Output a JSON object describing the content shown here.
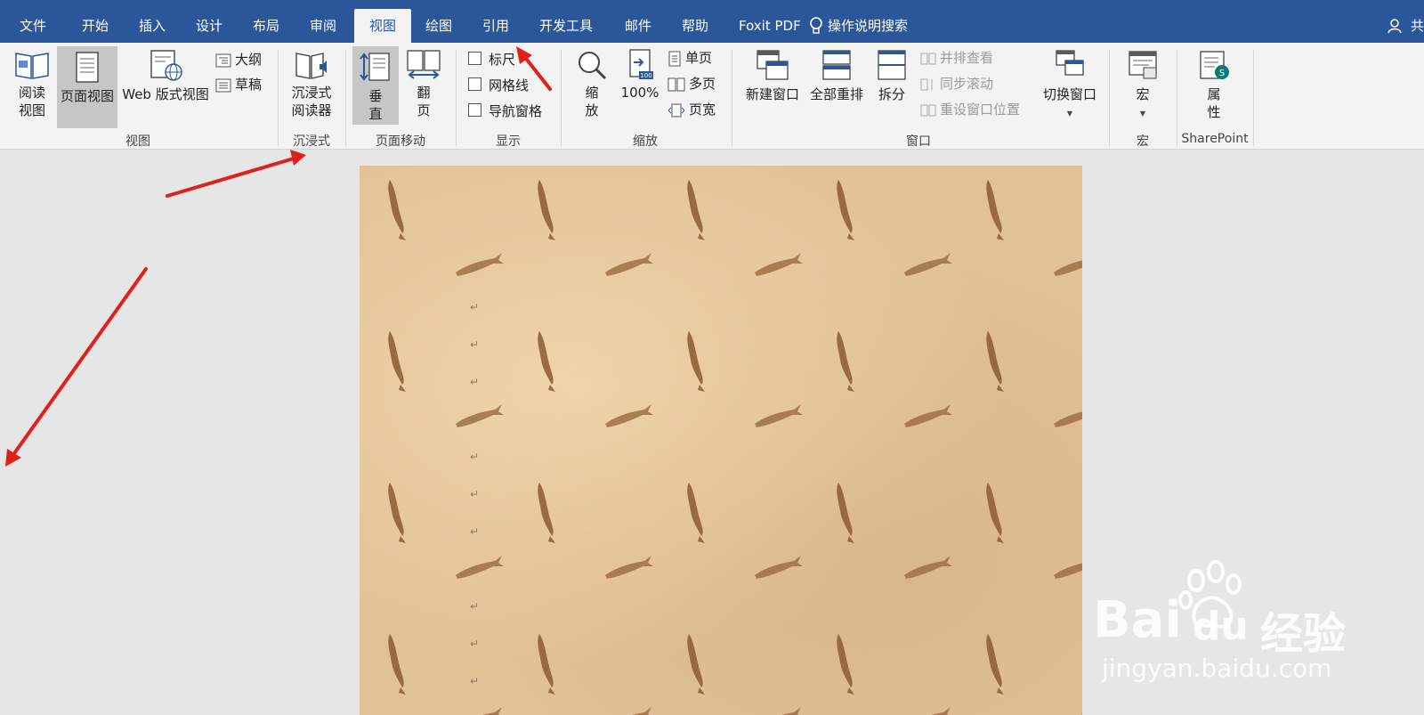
{
  "tabs": [
    "文件",
    "开始",
    "插入",
    "设计",
    "布局",
    "审阅",
    "视图",
    "绘图",
    "引用",
    "开发工具",
    "邮件",
    "帮助",
    "Foxit PDF"
  ],
  "active_tab": "视图",
  "tell_me": "操作说明搜索",
  "share": "共",
  "groups": {
    "views": {
      "label": "视图",
      "read_mode": "阅读\n视图",
      "print_layout": "页面视图",
      "web_layout": "Web 版式视图",
      "outline": "大纲",
      "draft": "草稿"
    },
    "immersive": {
      "label": "沉浸式",
      "reader": "沉浸式\n阅读器"
    },
    "page_movement": {
      "label": "页面移动",
      "vertical": "垂\n直",
      "side_to_side": "翻\n页"
    },
    "show": {
      "label": "显示",
      "ruler": "标尺",
      "gridlines": "网格线",
      "nav_pane": "导航窗格"
    },
    "zoom": {
      "label": "缩放",
      "zoom": "缩\n放",
      "hundred": "100%",
      "one_page": "单页",
      "multi_page": "多页",
      "page_width": "页宽"
    },
    "window": {
      "label": "窗口",
      "new_window": "新建窗口",
      "arrange_all": "全部重排",
      "split": "拆分",
      "side_by_side": "并排查看",
      "sync_scroll": "同步滚动",
      "reset_position": "重设窗口位置",
      "switch_windows": "切换窗口"
    },
    "macros": {
      "label": "宏",
      "macros": "宏"
    },
    "sharepoint": {
      "label": "SharePoint",
      "properties": "属\n性"
    }
  },
  "watermark": {
    "brand": "Bai",
    "brand2": "du",
    "cn": "经验",
    "url": "jingyan.baidu.com"
  },
  "colors": {
    "titlebar": "#2b579a",
    "ribbon": "#f3f3f3",
    "page": "#e2c196",
    "annotation": "#e0201b"
  }
}
